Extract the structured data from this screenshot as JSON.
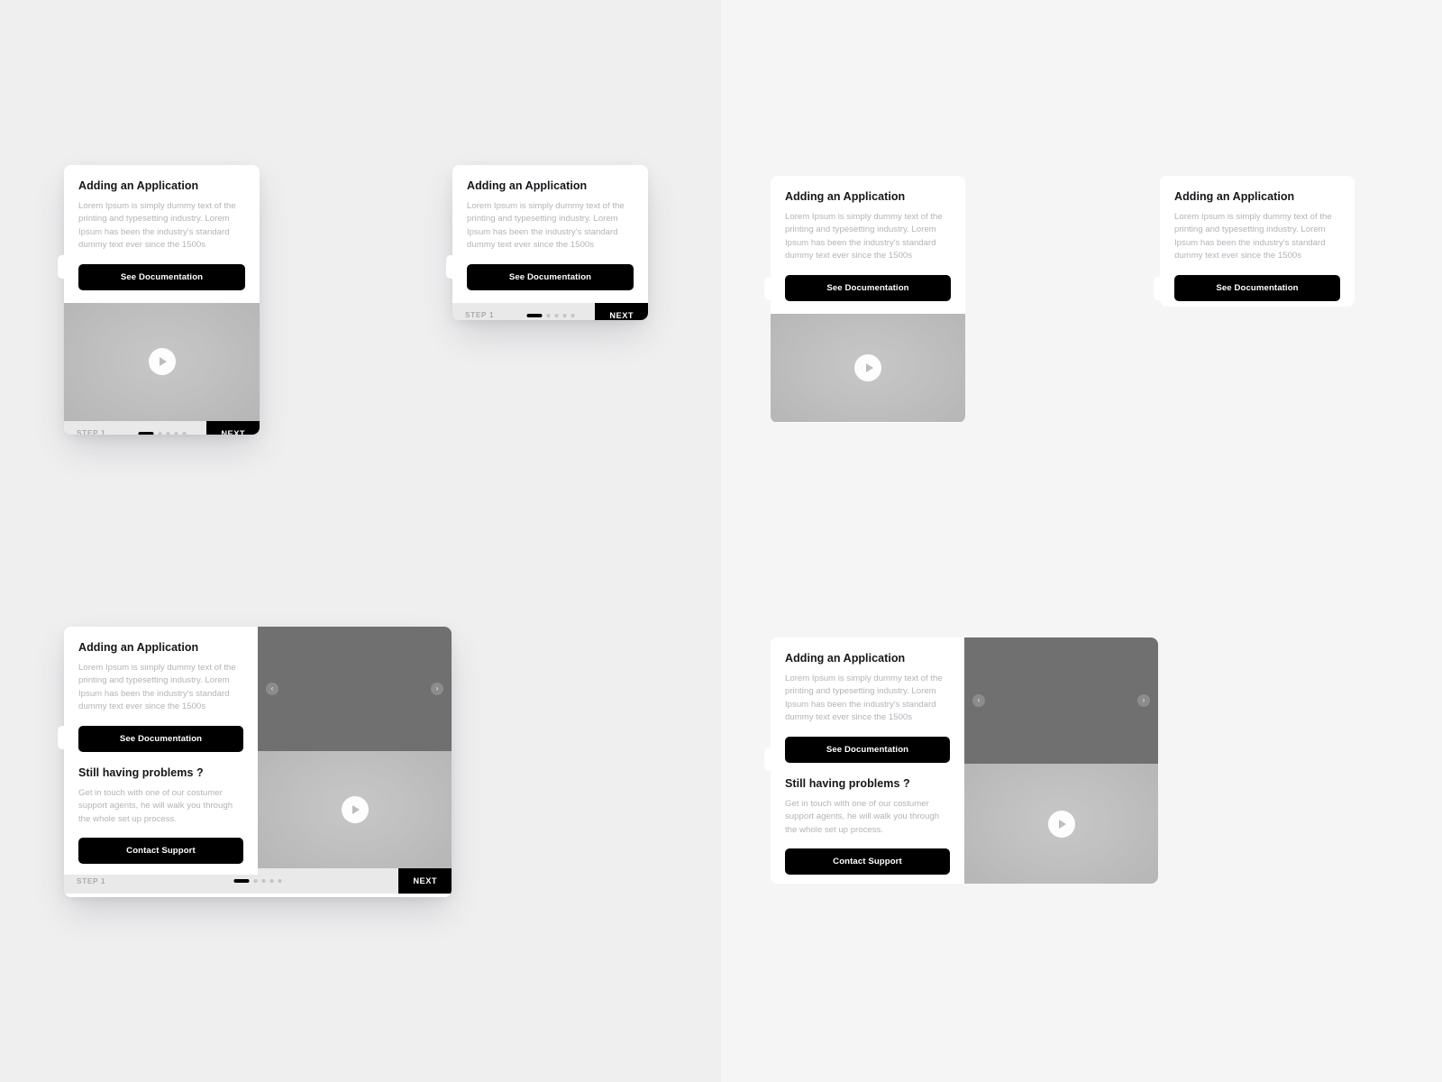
{
  "canvas": {
    "background_left": "#efeff0",
    "background_right": "#f5f5f6"
  },
  "strings": {
    "title": "Adding an Application",
    "body": "Lorem Ipsum is simply dummy text of the printing and typesetting industry. Lorem Ipsum has been the industry's standard dummy text ever since the 1500s",
    "primary_button": "See Documentation",
    "support_title": "Still having problems ?",
    "support_body": "Get in touch with one of our costumer support agents, he will walk you through the whole set up process.",
    "support_button": "Contact Support",
    "step_label": "STEP 1",
    "next_button": "NEXT",
    "play_icon": "play-icon",
    "prev_icon": "chevron-left-icon",
    "next_icon": "chevron-right-icon",
    "prev_glyph": "‹",
    "next_glyph": "›"
  },
  "stepper": {
    "total_steps": 5,
    "current_step": 1,
    "active_color": "#000000",
    "inactive_color": "#c3c4c7",
    "bar_background": "#e9e9ea"
  },
  "colors": {
    "card_surface": "#ffffff",
    "button_dark": "#000000",
    "body_text": "#b2b4b9",
    "title_text": "#15161a",
    "video_placeholder": "#c0c0c0",
    "carousel_placeholder": "#707070"
  },
  "cards": [
    {
      "id": "card-a",
      "name": "card-with-video-and-stepper",
      "has_video": true,
      "has_stepper": true,
      "has_support_section": false,
      "has_carousel": false
    },
    {
      "id": "card-b",
      "name": "card-with-stepper-only",
      "has_video": false,
      "has_stepper": true,
      "has_support_section": false,
      "has_carousel": false
    },
    {
      "id": "card-c",
      "name": "card-with-video-no-stepper",
      "has_video": true,
      "has_stepper": false,
      "has_support_section": false,
      "has_carousel": false
    },
    {
      "id": "card-d",
      "name": "card-content-only",
      "has_video": false,
      "has_stepper": false,
      "has_support_section": false,
      "has_carousel": false
    },
    {
      "id": "card-e",
      "name": "wide-card-with-support-and-stepper",
      "has_video": true,
      "has_stepper": true,
      "has_support_section": true,
      "has_carousel": true
    },
    {
      "id": "card-f",
      "name": "wide-card-with-support-no-stepper",
      "has_video": true,
      "has_stepper": false,
      "has_support_section": true,
      "has_carousel": true
    }
  ]
}
